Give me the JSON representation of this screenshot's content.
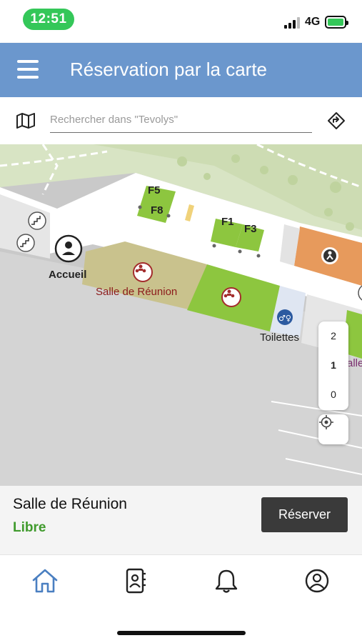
{
  "status_bar": {
    "time": "12:51",
    "network": "4G"
  },
  "header": {
    "title": "Réservation par la carte"
  },
  "search": {
    "placeholder": "Rechercher dans \"Tevolys\""
  },
  "map": {
    "rooms": [
      "F5",
      "F8",
      "F1",
      "F3"
    ],
    "labels": {
      "reception": "Accueil",
      "meeting_room": "Salle de Réunion",
      "toilets": "Toilettes",
      "partial": "alle"
    },
    "floors": [
      "2",
      "1",
      "0"
    ],
    "active_floor": "1"
  },
  "selected_room": {
    "name": "Salle de Réunion",
    "status": "Libre",
    "action_label": "Réserver"
  },
  "colors": {
    "header": "#6b97cd",
    "status_green": "#3f9a2c",
    "room_green": "#8dc63f",
    "room_olive": "#c9c28d",
    "room_orange": "#e79a5c",
    "nav_active": "#4a7fc1"
  },
  "nav": [
    {
      "icon": "home-icon",
      "active": true
    },
    {
      "icon": "contacts-icon",
      "active": false
    },
    {
      "icon": "bell-icon",
      "active": false
    },
    {
      "icon": "profile-icon",
      "active": false
    }
  ]
}
